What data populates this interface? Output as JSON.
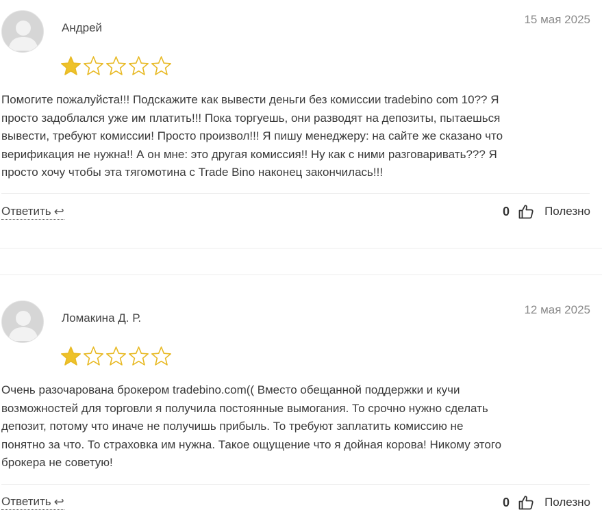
{
  "reviews": [
    {
      "author": "Андрей",
      "date": "15 мая 2025",
      "rating": 1,
      "max_rating": 5,
      "lines": [
        "Помогите пожалуйста!!! Подскажите как вывести деньги без комиссии tradebino com 10?? Я",
        "просто задоблался уже им платить!!! Пока торгуешь, они разводят на депозиты, пытаешься",
        "вывести, требуют комиссии! Просто произвол!!! Я пишу менеджеру: на сайте же сказано что",
        "верификация не нужна!! А он мне: это другая комиссия!! Ну как с ними разговаривать??? Я",
        "просто хочу чтобы эта тягомотина с Trade Bino наконец закончилась!!!"
      ],
      "reply_label": "Ответить",
      "vote_count": "0",
      "useful_label": "Полезно"
    },
    {
      "author": "Ломакина Д. Р.",
      "date": "12 мая 2025",
      "rating": 1,
      "max_rating": 5,
      "lines": [
        "Очень разочарована брокером tradebino.com(( Вместо обещанной поддержки и кучи",
        "возможностей для торговли я получила постоянные вымогания. То срочно нужно сделать",
        "депозит, потому что иначе не получишь прибыль. То требуют заплатить комиссию не",
        "понятно за что. То страховка им нужна. Такое ощущение что я дойная корова! Никому этого",
        "брокера не советую!"
      ],
      "reply_label": "Ответить",
      "vote_count": "0",
      "useful_label": "Полезно"
    }
  ],
  "colors": {
    "star_fill": "#eec22a",
    "star_outline": "#e8b923",
    "avatar_bg": "#d9d9d9",
    "avatar_fg": "#f2f2f2"
  },
  "icons": {
    "reply": "reply-arrow-icon",
    "thumb": "thumbs-up-icon",
    "star": "star-icon",
    "avatar": "user-silhouette-icon"
  }
}
